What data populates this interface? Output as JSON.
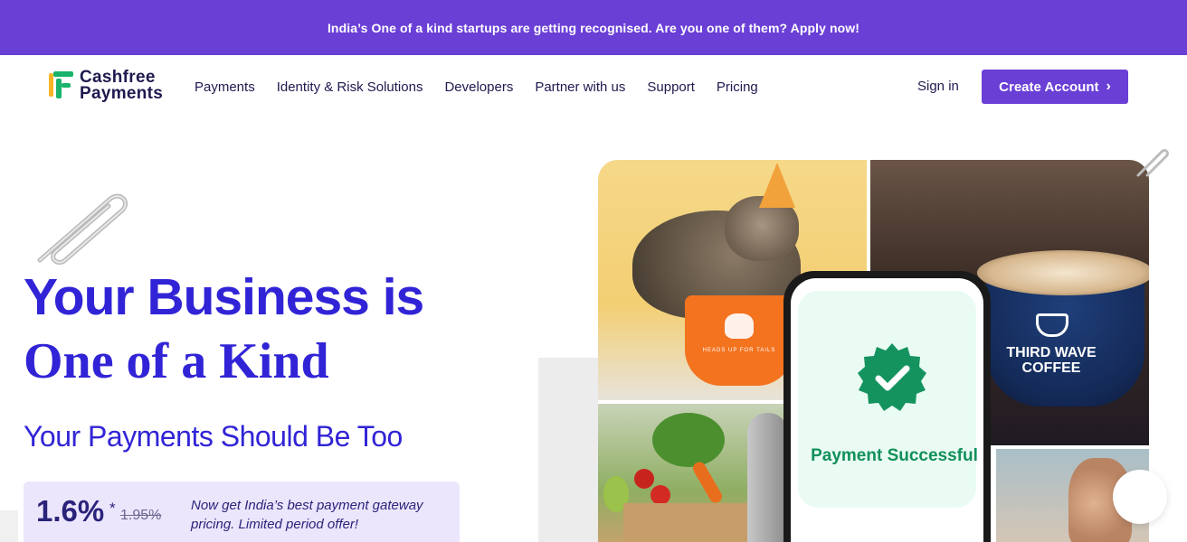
{
  "announcement": {
    "text": "India’s One of a kind startups are getting recognised. Are you one of them? Apply now!"
  },
  "header": {
    "logo": {
      "line1": "Cashfree",
      "line2": "Payments"
    },
    "nav": [
      "Payments",
      "Identity & Risk Solutions",
      "Developers",
      "Partner with us",
      "Support",
      "Pricing"
    ],
    "sign_in": "Sign in",
    "cta_label": "Create Account",
    "cta_icon": "chevron-right-icon"
  },
  "hero": {
    "headline_line1": "Your Business is",
    "headline_line2": "One of a Kind",
    "subheadline": "Your Payments Should Be Too",
    "offer": {
      "rate": "1.6%",
      "asterisk": "*",
      "old_rate": "1.95%",
      "description": "Now get India’s best payment gateway pricing. Limited period offer!"
    }
  },
  "collage": {
    "bowl_label": "HEADS UP FOR TAILS",
    "cup_brand": "THIRD WAVE COFFEE",
    "payment_status": "Payment Successful"
  },
  "colors": {
    "brand_purple": "#6a3fd6",
    "headline_blue": "#3124d6",
    "success_green": "#11905a",
    "offer_bg": "#ece6fd"
  }
}
